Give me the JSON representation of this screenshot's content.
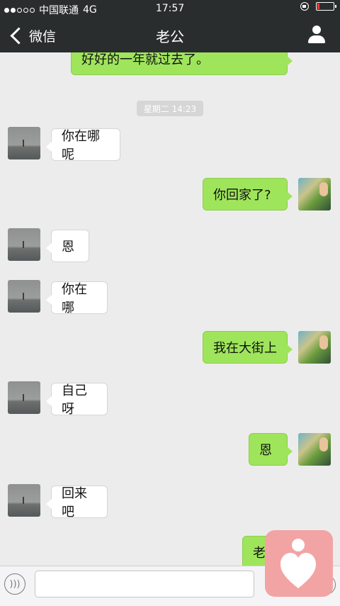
{
  "status_bar": {
    "signal_bars_filled": 2,
    "signal_bars_total": 5,
    "carrier": "中国联通",
    "network": "4G",
    "time": "17:57",
    "battery_level": 0.15
  },
  "nav": {
    "back_label": "微信",
    "title": "老公"
  },
  "messages": [
    {
      "side": "right",
      "text": "好好的一年就过去了。"
    },
    {
      "type": "timestamp",
      "text": "星期二 14:23"
    },
    {
      "side": "left",
      "text": "你在哪呢"
    },
    {
      "side": "right",
      "text": "你回家了?"
    },
    {
      "side": "left",
      "text": "恩"
    },
    {
      "side": "left",
      "text": "你在哪"
    },
    {
      "side": "right",
      "text": "我在大街上"
    },
    {
      "side": "left",
      "text": "自己呀"
    },
    {
      "side": "right",
      "text": "恩"
    },
    {
      "side": "left",
      "text": "回来吧"
    },
    {
      "side": "right",
      "text": "老"
    }
  ],
  "input": {
    "value": "",
    "placeholder": ""
  },
  "colors": {
    "nav_bg": "#2a2d2e",
    "chat_bg": "#ececec",
    "sent_bubble": "#9fe55b",
    "received_bubble": "#ffffff",
    "overlay_button": "#f2a4a4"
  },
  "icons": {
    "back": "chevron-left-icon",
    "profile": "user-icon",
    "voice": "voice-icon",
    "more": "plus-icon",
    "overlay": "heart-person-icon"
  }
}
